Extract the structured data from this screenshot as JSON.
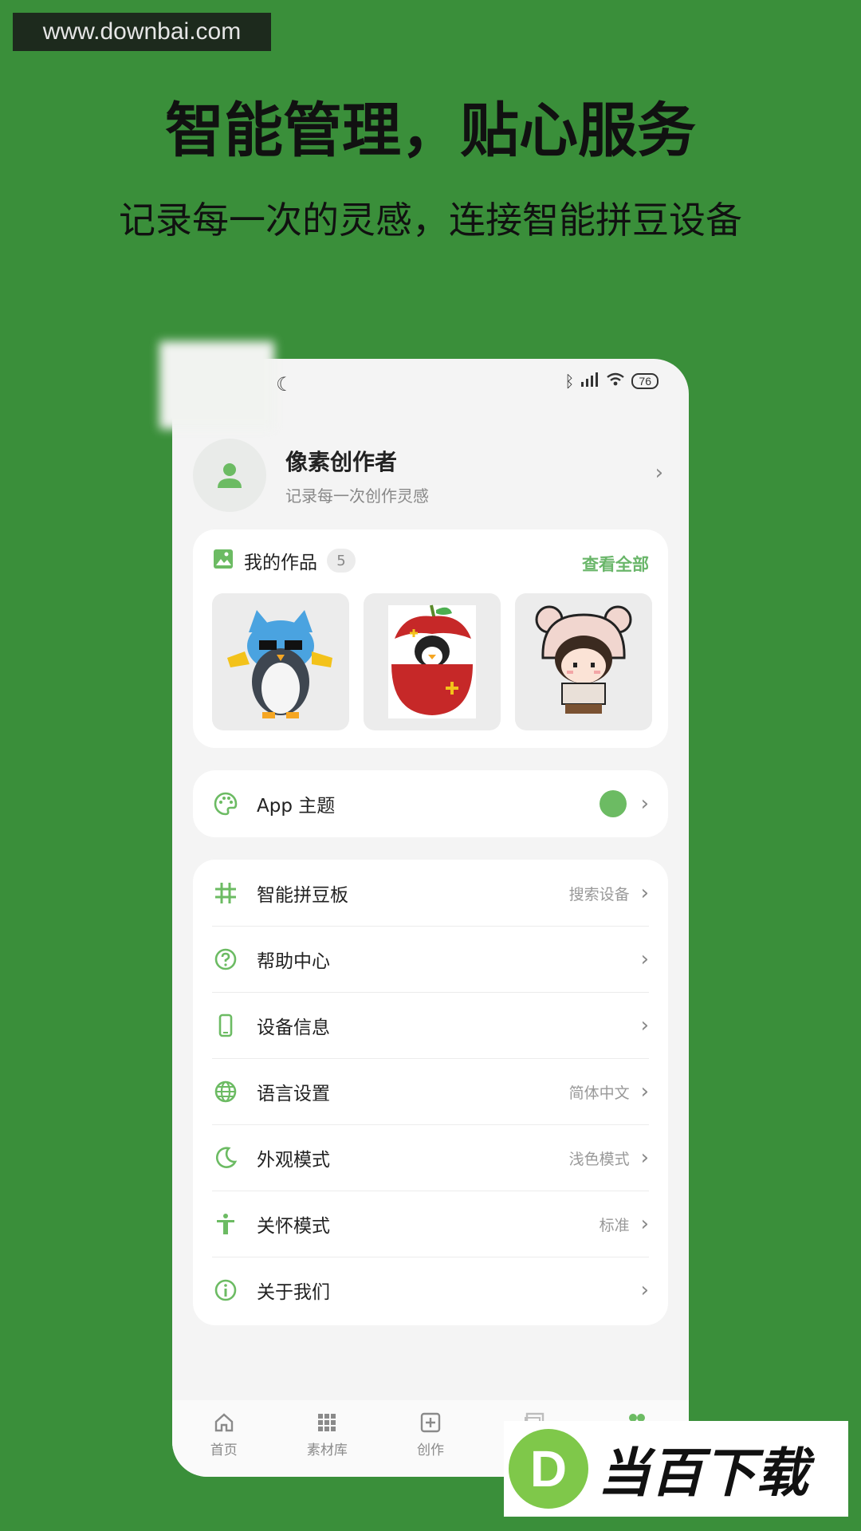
{
  "watermark": "www.downbai.com",
  "headline": "智能管理，贴心服务",
  "subline": "记录每一次的灵感，连接智能拼豆设备",
  "statusbar": {
    "battery": "76"
  },
  "profile": {
    "name": "像素创作者",
    "subtitle": "记录每一次创作灵感"
  },
  "works": {
    "title": "我的作品",
    "count": "5",
    "view_all": "查看全部",
    "items": [
      {
        "icon": "penguin-artwork"
      },
      {
        "icon": "apple-penguin-artwork"
      },
      {
        "icon": "bear-hat-girl-artwork"
      }
    ]
  },
  "theme": {
    "label": "App 主题",
    "color": "#6cbb63"
  },
  "settings": [
    {
      "label": "智能拼豆板",
      "value": "搜索设备",
      "icon": "grid-icon"
    },
    {
      "label": "帮助中心",
      "value": "",
      "icon": "help-icon"
    },
    {
      "label": "设备信息",
      "value": "",
      "icon": "phone-icon"
    },
    {
      "label": "语言设置",
      "value": "简体中文",
      "icon": "globe-icon"
    },
    {
      "label": "外观模式",
      "value": "浅色模式",
      "icon": "moon-icon"
    },
    {
      "label": "关怀模式",
      "value": "标准",
      "icon": "accessibility-icon"
    },
    {
      "label": "关于我们",
      "value": "",
      "icon": "info-icon"
    }
  ],
  "tabbar": [
    {
      "label": "首页",
      "icon": "home-icon"
    },
    {
      "label": "素材库",
      "icon": "grid-dots-icon"
    },
    {
      "label": "创作",
      "icon": "plus-square-icon"
    },
    {
      "label": "",
      "icon": "gallery-icon"
    },
    {
      "label": "",
      "icon": "profile-icon"
    }
  ],
  "logo_watermark": {
    "text": "当百下载",
    "letter": "D"
  },
  "colors": {
    "background": "#3a8f3a",
    "accent": "#6ab66a"
  }
}
